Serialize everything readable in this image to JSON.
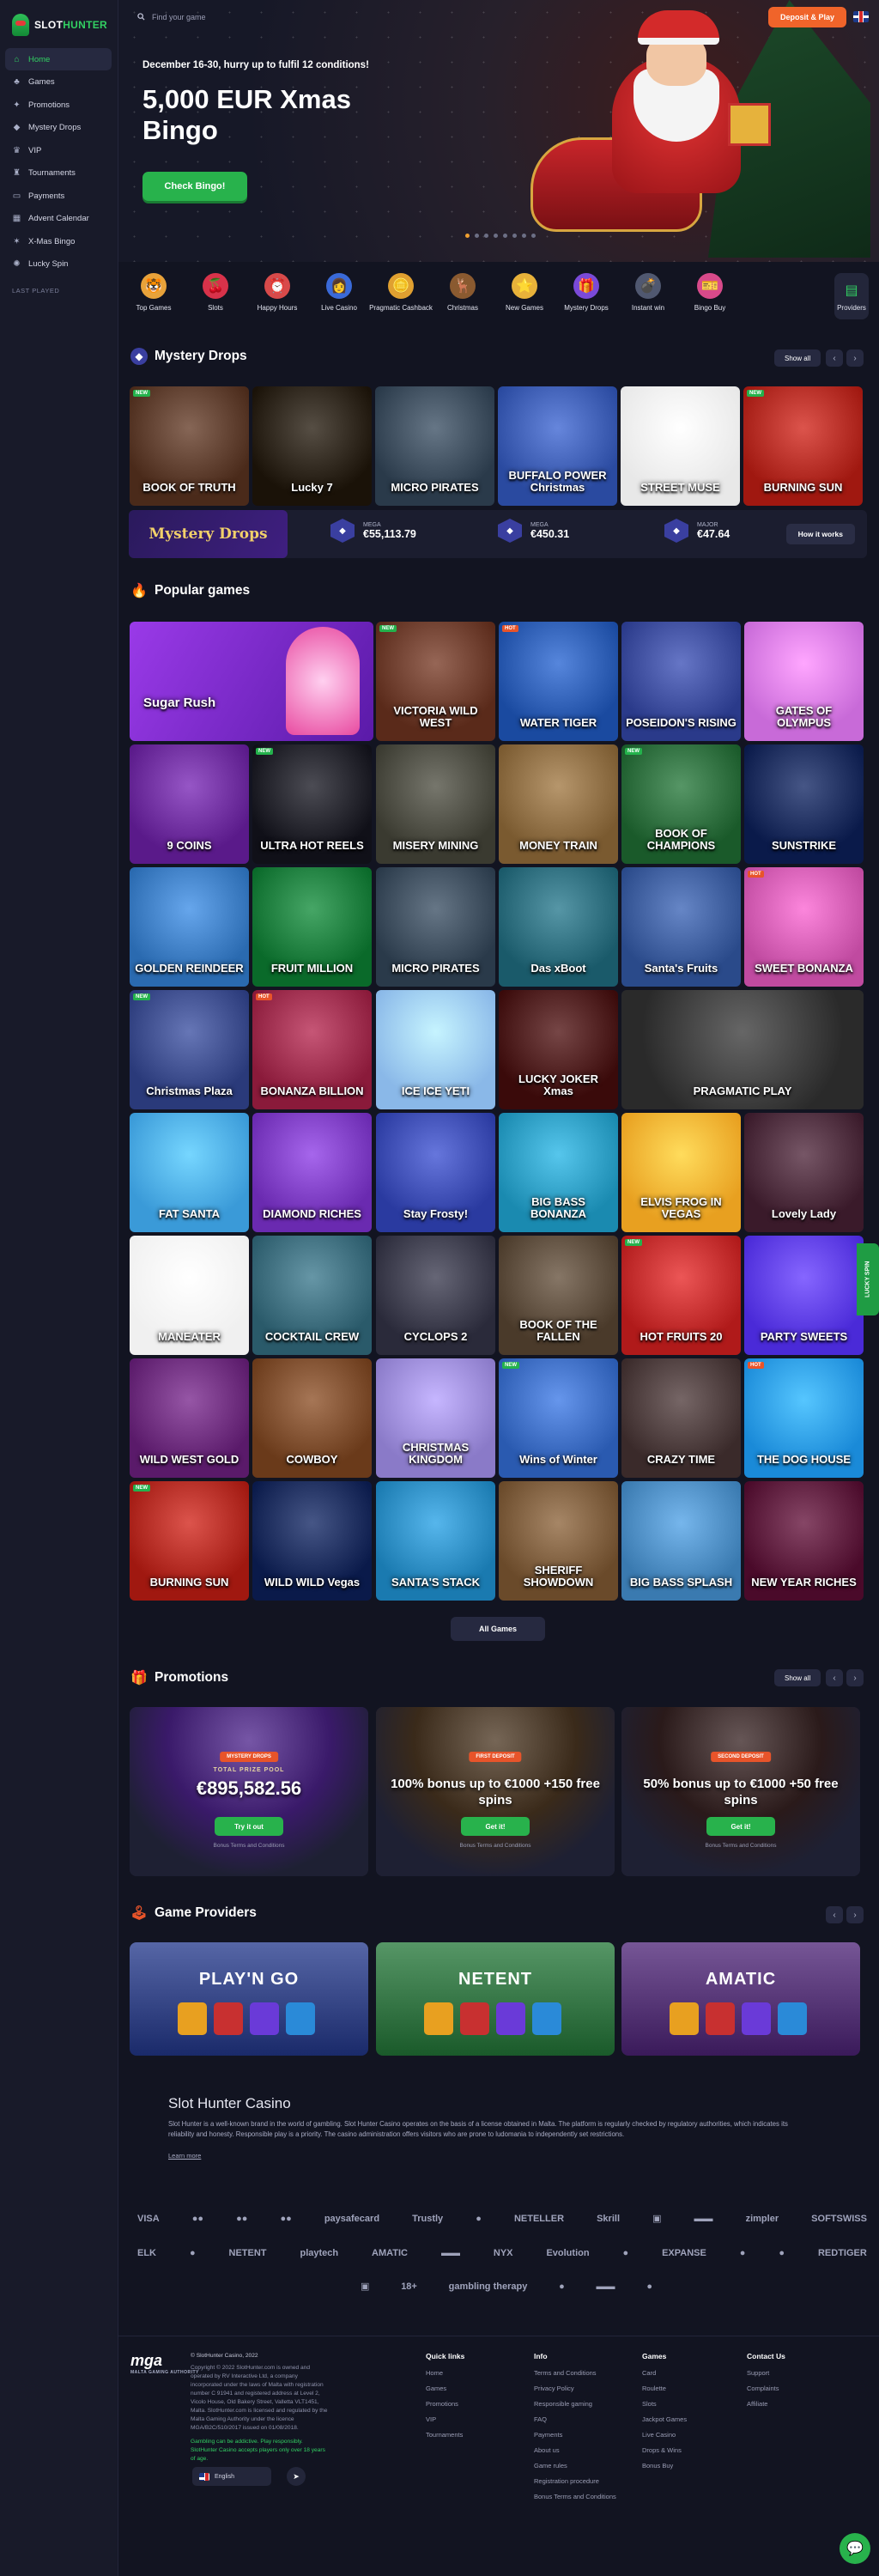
{
  "brand": {
    "name_part1": "SLOT",
    "name_part2": "HUNTER"
  },
  "search": {
    "placeholder": "Find your game"
  },
  "header": {
    "deposit_label": "Deposit & Play"
  },
  "sidebar": {
    "items": [
      {
        "label": "Home",
        "icon": "home-icon",
        "glyph": "⌂",
        "active": true
      },
      {
        "label": "Games",
        "icon": "games-icon",
        "glyph": "♣"
      },
      {
        "label": "Promotions",
        "icon": "promotions-icon",
        "glyph": "✦"
      },
      {
        "label": "Mystery Drops",
        "icon": "drops-icon",
        "glyph": "◆"
      },
      {
        "label": "VIP",
        "icon": "vip-icon",
        "glyph": "♛"
      },
      {
        "label": "Tournaments",
        "icon": "trophy-icon",
        "glyph": "♜"
      },
      {
        "label": "Payments",
        "icon": "wallet-icon",
        "glyph": "▭"
      },
      {
        "label": "Advent Calendar",
        "icon": "calendar-icon",
        "glyph": "▦"
      },
      {
        "label": "X-Mas Bingo",
        "icon": "bingo-icon",
        "glyph": "✶"
      },
      {
        "label": "Lucky Spin",
        "icon": "spin-icon",
        "glyph": "✺"
      }
    ],
    "last_played": "LAST PLAYED"
  },
  "hero": {
    "subtitle": "December 16-30, hurry up to fulfil 12 conditions!",
    "title": "5,000 EUR Xmas Bingo",
    "button": "Check Bingo!",
    "dots": 8,
    "active_dot": 0
  },
  "categories": [
    {
      "label": "Top Games",
      "glyph": "🐯",
      "color": "#e8a23a"
    },
    {
      "label": "Slots",
      "glyph": "🍒",
      "color": "#d8324a"
    },
    {
      "label": "Happy Hours",
      "glyph": "⏰",
      "color": "#d84a4a"
    },
    {
      "label": "Live Casino",
      "glyph": "👩",
      "color": "#3a6ad8"
    },
    {
      "label": "Pragmatic Cashback",
      "glyph": "🪙",
      "color": "#e0a030"
    },
    {
      "label": "Christmas",
      "glyph": "🦌",
      "color": "#8a5a30"
    },
    {
      "label": "New Games",
      "glyph": "⭐",
      "color": "#e8b23a"
    },
    {
      "label": "Mystery Drops",
      "glyph": "🎁",
      "color": "#7a4ad8"
    },
    {
      "label": "Instant win",
      "glyph": "💣",
      "color": "#505870"
    },
    {
      "label": "Bingo Buy",
      "glyph": "🎫",
      "color": "#d84a8a"
    }
  ],
  "providers_label": "Providers",
  "mystery": {
    "title": "Mystery Drops",
    "show_all": "Show all",
    "games": [
      {
        "name": "BOOK OF TRUTH",
        "bg": "#4a2a1a",
        "accent": "#d8a050",
        "badge": "NEW"
      },
      {
        "name": "Lucky 7",
        "bg": "#1a1208",
        "accent": "#e8c030"
      },
      {
        "name": "MICRO PIRATES",
        "bg": "#2a3a4a",
        "accent": "#c89030"
      },
      {
        "name": "BUFFALO POWER Christmas",
        "bg": "#2a4aa0",
        "accent": "#e04040"
      },
      {
        "name": "STREET MUSE",
        "bg": "#e8e8e8",
        "accent": "#202020"
      },
      {
        "name": "BURNING SUN",
        "bg": "#a01810",
        "accent": "#f0b020",
        "badge": "NEW"
      }
    ],
    "logo": "Mystery Drops",
    "jackpots": [
      {
        "label": "MEGA",
        "value": "€55,113.79"
      },
      {
        "label": "MEGA",
        "value": "€450.31"
      },
      {
        "label": "MAJOR",
        "value": "€47.64"
      }
    ],
    "how_it_works": "How it works"
  },
  "popular": {
    "title": "Popular games",
    "all_games": "All Games",
    "featured": {
      "name": "Sugar Rush",
      "bg": "#7a2ad8"
    },
    "games": [
      {
        "name": "VICTORIA WILD WEST",
        "bg": "#5a2a1a",
        "badge": "NEW"
      },
      {
        "name": "WATER TIGER",
        "bg": "#1a4aa0",
        "badge": "HOT"
      },
      {
        "name": "POSEIDON'S RISING",
        "bg": "#2a3a8a"
      },
      {
        "name": "GATES OF OLYMPUS",
        "bg": "#c86ad8"
      },
      {
        "name": "9 COINS",
        "bg": "#5a1a8a"
      },
      {
        "name": "ULTRA HOT REELS",
        "bg": "#101018",
        "badge": "NEW"
      },
      {
        "name": "MISERY MINING",
        "bg": "#3a3a30"
      },
      {
        "name": "MONEY TRAIN",
        "bg": "#7a5a30"
      },
      {
        "name": "BOOK OF CHAMPIONS",
        "bg": "#1a5a2a",
        "badge": "NEW"
      },
      {
        "name": "SUNSTRIKE",
        "bg": "#0a1a4a"
      },
      {
        "name": "GOLDEN REINDEER",
        "bg": "#2a6ab0"
      },
      {
        "name": "FRUIT MILLION",
        "bg": "#0a6a2a"
      },
      {
        "name": "MICRO PIRATES",
        "bg": "#2a3a4a"
      },
      {
        "name": "Das xBoot",
        "bg": "#1a5a6a"
      },
      {
        "name": "Santa's Fruits",
        "bg": "#2a4a8a"
      },
      {
        "name": "SWEET BONANZA",
        "bg": "#c04aa0",
        "badge": "HOT"
      },
      {
        "name": "Christmas Plaza",
        "bg": "#2a3a7a",
        "badge": "NEW"
      },
      {
        "name": "BONANZA BILLION",
        "bg": "#8a1a3a",
        "badge": "HOT"
      },
      {
        "name": "ICE ICE YETI",
        "bg": "#8ab8e8"
      },
      {
        "name": "LUCKY JOKER Xmas",
        "bg": "#3a0a0a"
      },
      {
        "name": "PRAGMATIC PLAY",
        "bg": "#2a2a2a"
      },
      {
        "name": "FAT SANTA",
        "bg": "#3a9ad8"
      },
      {
        "name": "DIAMOND RICHES",
        "bg": "#6a2ab0"
      },
      {
        "name": "Stay Frosty!",
        "bg": "#2a3aa0"
      },
      {
        "name": "BIG BASS BONANZA",
        "bg": "#1a8ab0"
      },
      {
        "name": "ELVIS FROG IN VEGAS",
        "bg": "#e8a020"
      },
      {
        "name": "Lovely Lady",
        "bg": "#3a1a2a"
      },
      {
        "name": "MANEATER",
        "bg": "#f0f0f0"
      },
      {
        "name": "COCKTAIL CREW",
        "bg": "#2a5a6a"
      },
      {
        "name": "CYCLOPS 2",
        "bg": "#2a2a3a"
      },
      {
        "name": "BOOK OF THE FALLEN",
        "bg": "#4a3a2a"
      },
      {
        "name": "HOT FRUITS 20",
        "bg": "#b01a1a",
        "badge": "NEW"
      },
      {
        "name": "PARTY SWEETS",
        "bg": "#4a2ad8"
      },
      {
        "name": "WILD WEST GOLD",
        "bg": "#5a1a6a"
      },
      {
        "name": "COWBOY",
        "bg": "#6a3a1a"
      },
      {
        "name": "CHRISTMAS KINGDOM",
        "bg": "#8a7ac8"
      },
      {
        "name": "Wins of Winter",
        "bg": "#2a5ab0",
        "badge": "NEW"
      },
      {
        "name": "CRAZY TIME",
        "bg": "#3a2a2a"
      },
      {
        "name": "THE DOG HOUSE",
        "bg": "#1a8ad8",
        "badge": "HOT"
      },
      {
        "name": "BURNING SUN",
        "bg": "#a01810",
        "badge": "NEW"
      },
      {
        "name": "WILD WILD Vegas",
        "bg": "#0a1a4a"
      },
      {
        "name": "SANTA'S STACK",
        "bg": "#1a7ab0"
      },
      {
        "name": "SHERIFF SHOWDOWN",
        "bg": "#6a4a2a"
      },
      {
        "name": "BIG BASS SPLASH",
        "bg": "#3a7ab0"
      },
      {
        "name": "NEW YEAR RICHES",
        "bg": "#4a0a2a"
      }
    ]
  },
  "promotions": {
    "title": "Promotions",
    "show_all": "Show all",
    "cards": [
      {
        "tag": "MYSTERY DROPS",
        "mini": "TOTAL PRIZE POOL",
        "big": "€895,582.56",
        "button": "Try it out",
        "terms": "Bonus Terms and Conditions",
        "bg": "#3a1a6a"
      },
      {
        "tag": "FIRST DEPOSIT",
        "title": "100% bonus up to €1000 +150 free spins",
        "button": "Get it!",
        "terms": "Bonus Terms and Conditions",
        "bg": "#3a2a1a"
      },
      {
        "tag": "SECOND DEPOSIT",
        "title": "50% bonus up to €1000 +50 free spins",
        "button": "Get it!",
        "terms": "Bonus Terms and Conditions",
        "bg": "#2a1a1a"
      }
    ]
  },
  "providers": {
    "title": "Game Providers",
    "items": [
      {
        "name": "PLAY'N GO",
        "bg": "#1a2a6a"
      },
      {
        "name": "NETENT",
        "bg": "#1a5a2a"
      },
      {
        "name": "AMATIC",
        "bg": "#3a1a5a"
      }
    ]
  },
  "about": {
    "title": "Slot Hunter Casino",
    "text": "Slot Hunter is a well-known brand in the world of gambling. Slot Hunter Casino operates on the basis of a license obtained in Malta. The platform is regularly checked by regulatory authorities, which indicates its reliability and honesty. Responsible play is a priority. The casino administration offers visitors who are prone to ludomania to independently set restrictions.",
    "learn_more": "Learn more"
  },
  "payments_row1": [
    "VISA",
    "●●",
    "●●",
    "●●",
    "paysafecard",
    "Trustly",
    "●",
    "NETELLER",
    "Skrill",
    "▣",
    "▬▬",
    "zimpler",
    "SOFTSWISS"
  ],
  "payments_row2": [
    "ELK",
    "●",
    "NETENT",
    "playtech",
    "AMATIC",
    "▬▬",
    "NYX",
    "Evolution",
    "●",
    "EXPANSE",
    "●",
    "●",
    "REDTIGER"
  ],
  "payments_row3": [
    "▣",
    "18+",
    "gambling therapy",
    "●",
    "▬▬",
    "●"
  ],
  "footer": {
    "logo": "mga",
    "logo_sub": "MALTA GAMING AUTHORITY",
    "copy_title": "© SlotHunter Casino, 2022",
    "copy_text": "Copyright © 2022 SlotHunter.com is owned and operated by RV Interactive Ltd, a company incorporated under the laws of Malta with registration number C 91941 and registered address at Level 2, Vicolo House, Old Bakery Street, Valletta VLT1451, Malta. SlotHunter.com is licensed and regulated by the Malta Gaming Authority under the licence MGA/B2C/510/2017 issued on 01/08/2018.",
    "responsible": "Gambling can be addictive. Play responsibly. SlotHunter Casino accepts players only over 18 years of age.",
    "language": "English",
    "columns": [
      {
        "title": "Quick links",
        "links": [
          "Home",
          "Games",
          "Promotions",
          "VIP",
          "Tournaments"
        ]
      },
      {
        "title": "Info",
        "links": [
          "Terms and Conditions",
          "Privacy Policy",
          "Responsible gaming",
          "FAQ",
          "Payments",
          "About us",
          "Game rules",
          "Registration procedure",
          "Bonus Terms and Conditions"
        ]
      },
      {
        "title": "Games",
        "links": [
          "Card",
          "Roulette",
          "Slots",
          "Jackpot Games",
          "Live Casino",
          "Drops & Wins",
          "Bonus Buy"
        ]
      },
      {
        "title": "Contact Us",
        "links": [
          "Support",
          "Complaints",
          "Affiliate"
        ]
      }
    ]
  },
  "lucky_spin_tab": "LUCKY SPIN"
}
